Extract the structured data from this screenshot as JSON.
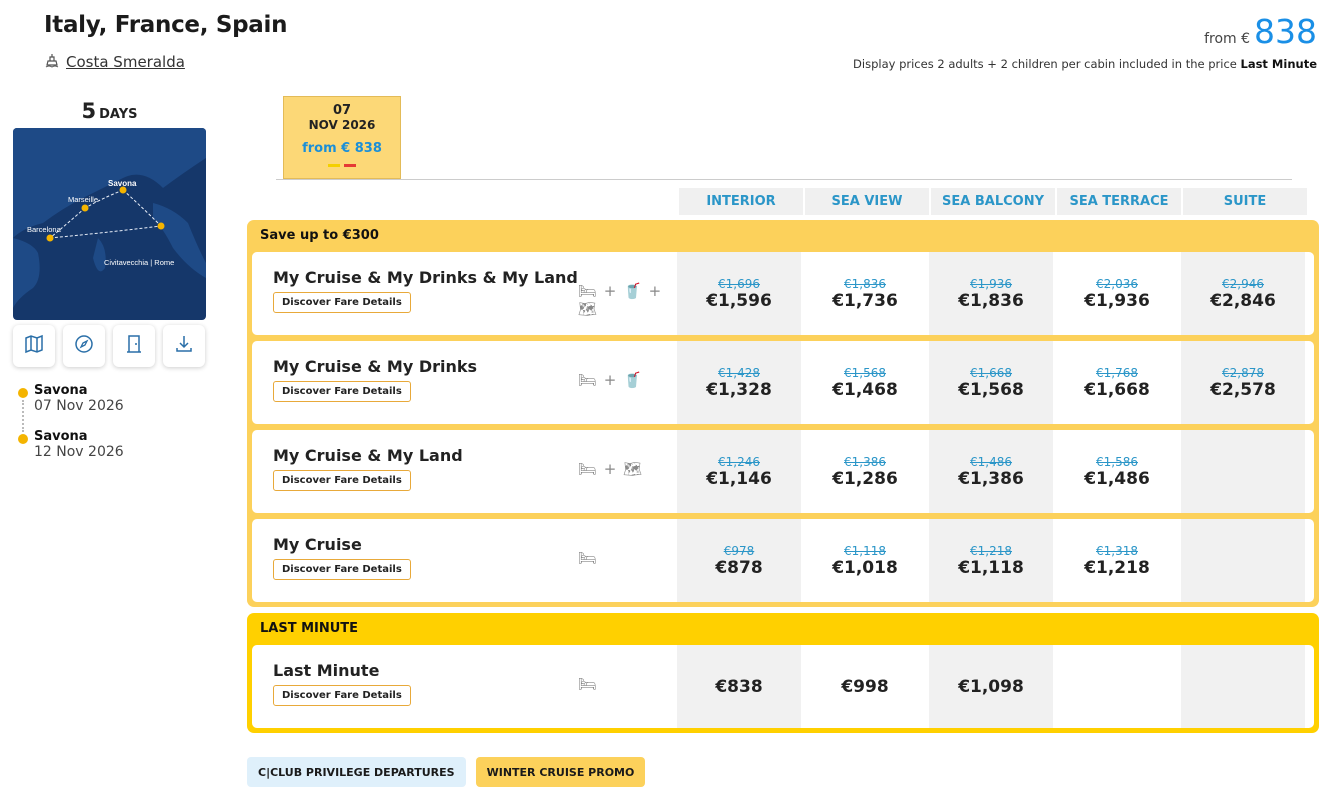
{
  "header": {
    "title": "Italy, France, Spain",
    "ship": "Costa Smeralda",
    "from_label": "from €",
    "from_price": "838",
    "note": "Display prices 2 adults + 2 children per cabin included in the price",
    "note_bold": "Last Minute"
  },
  "itinerary": {
    "days_number": "5",
    "days_label": "DAYS",
    "map_labels": [
      "Savona",
      "Marseille",
      "Barcelona",
      "Civitavecchia | Rome"
    ],
    "stops": [
      {
        "name": "Savona",
        "date": "07 Nov 2026"
      },
      {
        "name": "Savona",
        "date": "12 Nov 2026"
      }
    ]
  },
  "datetab": {
    "day": "07",
    "month_year": "NOV 2026",
    "from": "from € 838"
  },
  "columns": [
    "INTERIOR",
    "SEA VIEW",
    "SEA BALCONY",
    "SEA TERRACE",
    "SUITE"
  ],
  "groups": [
    {
      "title": "Save up to €300",
      "rows": [
        {
          "name": "My Cruise & My Drinks & My Land",
          "button": "Discover Fare Details",
          "features": "bed + drinks + land",
          "prices": [
            {
              "old": "€1,696",
              "new": "€1,596"
            },
            {
              "old": "€1,836",
              "new": "€1,736"
            },
            {
              "old": "€1,936",
              "new": "€1,836"
            },
            {
              "old": "€2,036",
              "new": "€1,936"
            },
            {
              "old": "€2,946",
              "new": "€2,846"
            }
          ]
        },
        {
          "name": "My Cruise & My Drinks",
          "button": "Discover Fare Details",
          "features": "bed + drinks",
          "prices": [
            {
              "old": "€1,428",
              "new": "€1,328"
            },
            {
              "old": "€1,568",
              "new": "€1,468"
            },
            {
              "old": "€1,668",
              "new": "€1,568"
            },
            {
              "old": "€1,768",
              "new": "€1,668"
            },
            {
              "old": "€2,878",
              "new": "€2,578"
            }
          ]
        },
        {
          "name": "My Cruise & My Land",
          "button": "Discover Fare Details",
          "features": "bed + land",
          "prices": [
            {
              "old": "€1,246",
              "new": "€1,146"
            },
            {
              "old": "€1,386",
              "new": "€1,286"
            },
            {
              "old": "€1,486",
              "new": "€1,386"
            },
            {
              "old": "€1,586",
              "new": "€1,486"
            },
            {
              "old": "",
              "new": ""
            }
          ]
        },
        {
          "name": "My Cruise",
          "button": "Discover Fare Details",
          "features": "bed",
          "prices": [
            {
              "old": "€978",
              "new": "€878"
            },
            {
              "old": "€1,118",
              "new": "€1,018"
            },
            {
              "old": "€1,218",
              "new": "€1,118"
            },
            {
              "old": "€1,318",
              "new": "€1,218"
            },
            {
              "old": "",
              "new": ""
            }
          ]
        }
      ]
    },
    {
      "title": "LAST MINUTE",
      "rows": [
        {
          "name": "Last Minute",
          "button": "Discover Fare Details",
          "features": "bed",
          "prices": [
            {
              "old": "",
              "new": "€838"
            },
            {
              "old": "",
              "new": "€998"
            },
            {
              "old": "",
              "new": "€1,098"
            },
            {
              "old": "",
              "new": ""
            },
            {
              "old": "",
              "new": ""
            }
          ]
        }
      ]
    }
  ],
  "promos": [
    "C|CLUB PRIVILEGE DEPARTURES",
    "WINTER CRUISE PROMO"
  ],
  "colors": {
    "accent": "#1a8fe6",
    "group": "#fcd15b",
    "last_minute": "#ffd000",
    "dot": "#f4b400"
  }
}
